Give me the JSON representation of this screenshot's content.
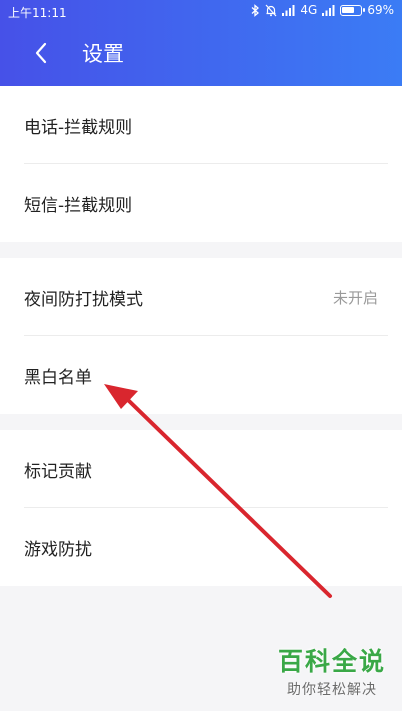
{
  "status_bar": {
    "time": "上午11:11",
    "network": "4G",
    "battery": "69%",
    "battery_level": 0.69,
    "icons": [
      "bluetooth-icon",
      "bell-off-icon",
      "signal-icon",
      "signal-icon",
      "battery-icon"
    ]
  },
  "header": {
    "title": "设置",
    "back_icon": "chevron-left-icon",
    "gradient_start": "#4651e8",
    "gradient_end": "#3b7cf5"
  },
  "groups": [
    {
      "items": [
        {
          "label": "电话-拦截规则"
        },
        {
          "label": "短信-拦截规则"
        }
      ]
    },
    {
      "items": [
        {
          "label": "夜间防打扰模式",
          "value": "未开启"
        },
        {
          "label": "黑白名单"
        }
      ]
    },
    {
      "items": [
        {
          "label": "标记贡献"
        },
        {
          "label": "游戏防扰"
        }
      ]
    }
  ],
  "annotation": {
    "color": "#d9262e",
    "target": "黑白名单"
  },
  "watermark": {
    "title": "百科全说",
    "subtitle": "助你轻松解决",
    "color": "#3aa847"
  }
}
